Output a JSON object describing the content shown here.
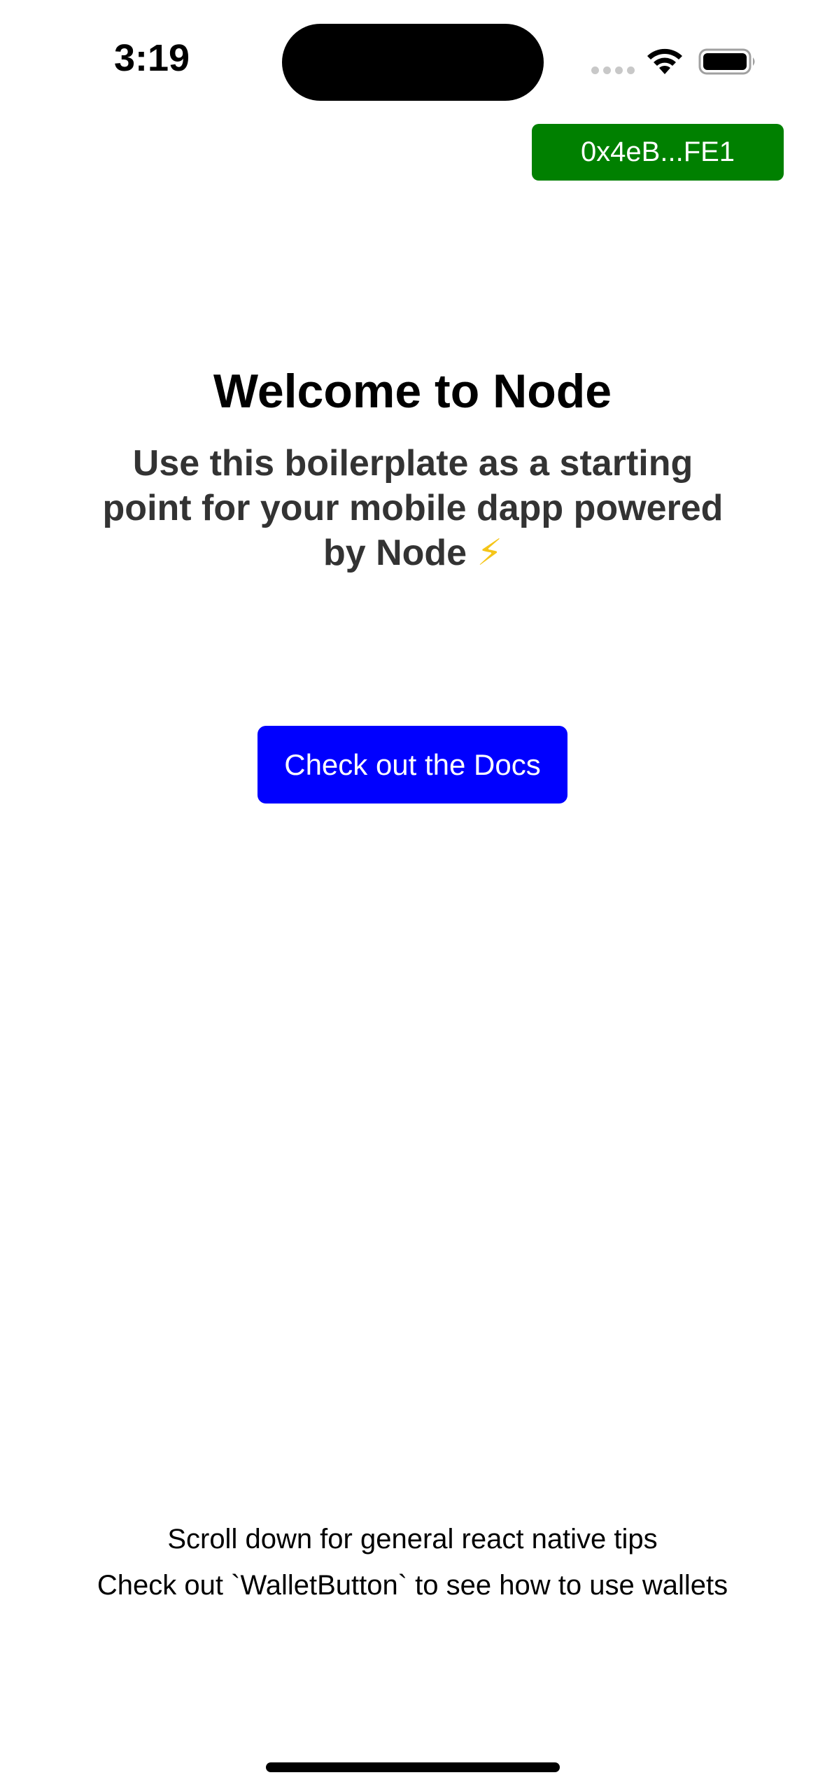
{
  "status_bar": {
    "time": "3:19",
    "icons": [
      "cellular-signal-icon",
      "wifi-icon",
      "battery-icon"
    ]
  },
  "wallet": {
    "address_label": "0x4eB...FE1",
    "button_color": "#008000"
  },
  "hero": {
    "title": "Welcome to Node",
    "subtitle": "Use this boilerplate as a starting point for your mobile dapp powered by Node",
    "subtitle_emoji": "⚡"
  },
  "docs": {
    "button_label": "Check out the Docs",
    "button_color": "#0000ff"
  },
  "footer": {
    "tip_1": "Scroll down for general react native tips",
    "tip_2": "Check out `WalletButton` to see how to use wallets"
  }
}
